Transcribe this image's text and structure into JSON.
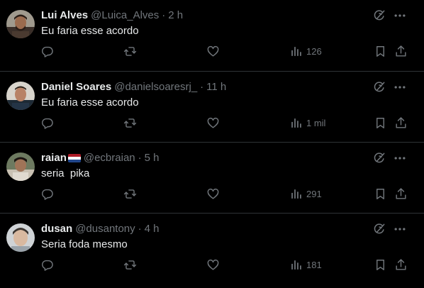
{
  "colors": {
    "background": "#000000",
    "text": "#e7e9ea",
    "muted": "#71767b",
    "divider": "#2f3336"
  },
  "tweets": [
    {
      "name": "Lui Alves",
      "handle": "@Luica_Alves",
      "time": "2 h",
      "text": "Eu faria esse acordo",
      "views": "126",
      "avatar": "avatar-photo"
    },
    {
      "name": "Daniel Soares",
      "handle": "@danielsoaresrj_",
      "time": "11 h",
      "text": "Eu faria esse acordo",
      "views": "1 mil",
      "avatar": "avatar-photo"
    },
    {
      "name": "raian",
      "flag": "netherlands-flag",
      "handle": "@ecbraian",
      "time": "5 h",
      "text": "seria  pika",
      "views": "291",
      "avatar": "avatar-photo"
    },
    {
      "name": "dusan",
      "handle": "@dusantony",
      "time": "4 h",
      "text": "Seria foda mesmo",
      "views": "181",
      "avatar": "avatar-photo"
    }
  ],
  "separator": "·"
}
